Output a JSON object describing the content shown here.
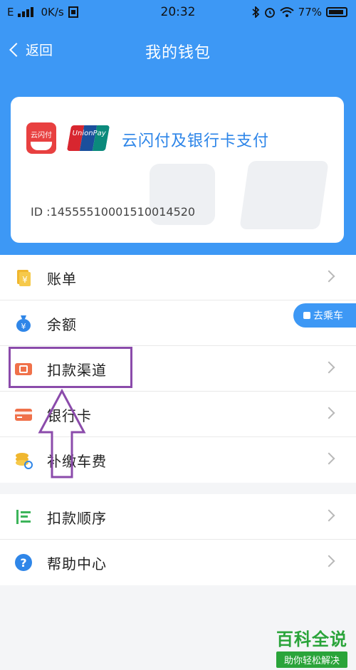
{
  "status_bar": {
    "carrier": "E",
    "speed": "0K/s",
    "time": "20:32",
    "battery": "77%"
  },
  "nav": {
    "back_label": "返回",
    "title": "我的钱包"
  },
  "card": {
    "logo_ysf": "云闪付",
    "logo_unionpay": "UnionPay",
    "title": "云闪付及银行卡支付",
    "id_text": "ID :14555510001510014520"
  },
  "list_group_1": [
    {
      "label": "账单",
      "icon": "bill-icon"
    },
    {
      "label": "余额",
      "icon": "balance-icon"
    },
    {
      "label": "扣款渠道",
      "icon": "payment-channel-icon"
    },
    {
      "label": "银行卡",
      "icon": "bank-card-icon"
    },
    {
      "label": "补缴车费",
      "icon": "fare-payment-icon"
    }
  ],
  "list_group_2": [
    {
      "label": "扣款顺序",
      "icon": "payment-order-icon"
    },
    {
      "label": "帮助中心",
      "icon": "help-icon"
    }
  ],
  "floating_button": {
    "label": "去乘车"
  },
  "watermark": {
    "brand": "百科全说",
    "slogan": "助你轻松解决"
  },
  "colors": {
    "primary": "#3d98f5",
    "highlight": "#8b4bab",
    "card_title": "#2b84e8"
  }
}
